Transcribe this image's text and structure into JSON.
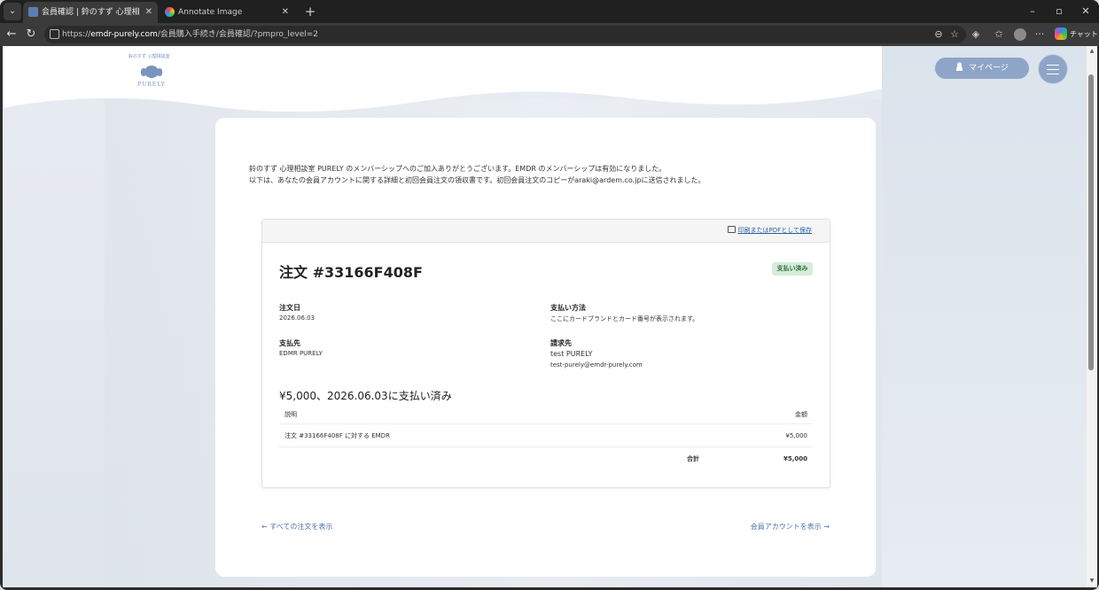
{
  "browser": {
    "tabs": [
      {
        "title": "会員確認 | 鈴のすず 心理相談室 PU",
        "active": true
      },
      {
        "title": "Annotate Image",
        "active": false
      }
    ],
    "url_prefix": "https://",
    "url_host": "emdr-purely.com",
    "url_path": "/会員購入手続き/会員確認/?pmpro_level=2",
    "copilot_label": "チャット"
  },
  "site": {
    "logo_tagline": "鈴のすず 心理相談室",
    "logo_name": "PURELY",
    "mypage_label": "マイページ"
  },
  "confirmation": {
    "intro_line1": "鈴のすず 心理相談室 PURELY のメンバーシップへのご加入ありがとうございます。EMDR のメンバーシップは有効になりました。",
    "intro_line2": "以下は、あなたの会員アカウントに関する詳細と初回会員注文の領収書です。初回会員注文のコピーがaraki@ardem.co.jpに送信されました。"
  },
  "invoice": {
    "print_link": "印刷またはPDFとして保存",
    "title": "注文 #33166F408F",
    "status": "支払い済み",
    "order_date_label": "注文日",
    "order_date": "2026.06.03",
    "payment_method_label": "支払い方法",
    "payment_method": "ここにカードブランドとカード番号が表示されます。",
    "pay_to_label": "支払先",
    "pay_to": "EDMR PURELY",
    "bill_to_label": "請求先",
    "bill_to_name": "test PURELY",
    "bill_to_email": "test-purely@emdr-purely.com",
    "paid_summary": "¥5,000、2026.06.03に支払い済み",
    "table": {
      "col_description": "説明",
      "col_amount": "金額",
      "rows": [
        {
          "description": "注文 #33166F408F に対する EMDR",
          "amount": "¥5,000"
        }
      ],
      "total_label": "合計",
      "total_value": "¥5,000"
    }
  },
  "footer": {
    "view_orders": "← すべての注文を表示",
    "view_account": "会員アカウントを表示 →"
  }
}
